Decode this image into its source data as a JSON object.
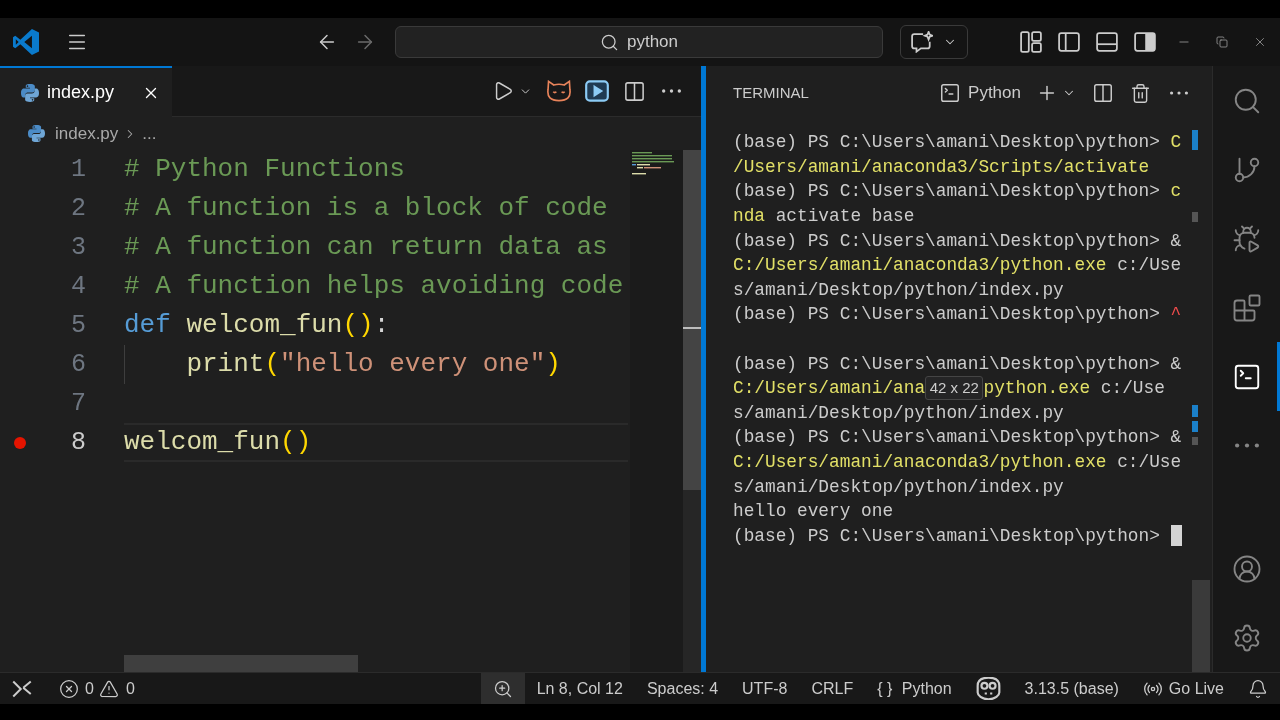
{
  "title_bar": {
    "command_center": "python",
    "layout_toggles": [
      {
        "kind": "primary_sidebar",
        "on": false
      },
      {
        "kind": "panel",
        "on": false
      },
      {
        "kind": "secondary_sidebar",
        "on": true
      }
    ]
  },
  "editor": {
    "tabs": [
      {
        "label": "index.py",
        "selected": true
      }
    ],
    "breadcrumb": [
      "index.py",
      "..."
    ],
    "lines": [
      {
        "number": "1",
        "current": false,
        "breakpoint": false,
        "indented": false,
        "tokens": [
          {
            "text": "# Python Functions",
            "kind": "comment"
          }
        ]
      },
      {
        "number": "2",
        "current": false,
        "breakpoint": false,
        "indented": false,
        "tokens": [
          {
            "text": "# A function is a block of code",
            "kind": "comment"
          }
        ]
      },
      {
        "number": "3",
        "current": false,
        "breakpoint": false,
        "indented": false,
        "tokens": [
          {
            "text": "# A function can return data as",
            "kind": "comment"
          }
        ]
      },
      {
        "number": "4",
        "current": false,
        "breakpoint": false,
        "indented": false,
        "tokens": [
          {
            "text": "# A function helps avoiding code",
            "kind": "comment"
          }
        ]
      },
      {
        "number": "5",
        "current": false,
        "breakpoint": false,
        "indented": false,
        "tokens": [
          {
            "text": "def ",
            "kind": "keyword"
          },
          {
            "text": "welcom_fun",
            "kind": "function"
          },
          {
            "text": "()",
            "kind": "bracket"
          },
          {
            "text": ":",
            "kind": "plain"
          }
        ]
      },
      {
        "number": "6",
        "current": false,
        "breakpoint": false,
        "indented": true,
        "tokens": [
          {
            "text": "print",
            "kind": "function"
          },
          {
            "text": "(",
            "kind": "bracket"
          },
          {
            "text": "\"hello every one\"",
            "kind": "string"
          },
          {
            "text": ")",
            "kind": "bracket"
          }
        ]
      },
      {
        "number": "7",
        "current": false,
        "breakpoint": false,
        "indented": false
      },
      {
        "number": "8",
        "current": true,
        "breakpoint": true,
        "indented": false,
        "tokens": [
          {
            "text": "welcom_fun",
            "kind": "function"
          },
          {
            "text": "()",
            "kind": "bracket"
          }
        ]
      }
    ]
  },
  "terminal": {
    "title": "TERMINAL",
    "shell": "Python",
    "tooltip": "42 x 22",
    "lines": [
      {
        "kind": "text",
        "segments": [
          {
            "text": "(base) PS C:\\Users\\amani\\Desktop\\python> ",
            "kind": "plain"
          },
          {
            "text": "C",
            "kind": "command"
          }
        ]
      },
      {
        "kind": "text",
        "segments": [
          {
            "text": "/Users/amani/anaconda3/Scripts/activate",
            "kind": "command"
          }
        ]
      },
      {
        "kind": "text",
        "segments": [
          {
            "text": "(base) PS C:\\Users\\amani\\Desktop\\python> ",
            "kind": "plain"
          },
          {
            "text": "c",
            "kind": "command"
          }
        ]
      },
      {
        "kind": "text",
        "segments": [
          {
            "text": "nda",
            "kind": "command"
          },
          {
            "text": " activate base",
            "kind": "plain"
          }
        ]
      },
      {
        "kind": "text",
        "segments": [
          {
            "text": "(base) PS C:\\Users\\amani\\Desktop\\python> &",
            "kind": "plain"
          }
        ]
      },
      {
        "kind": "text",
        "segments": [
          {
            "text": "C:/Users/amani/anaconda3/python.exe",
            "kind": "command"
          },
          {
            "text": " c:/Use",
            "kind": "plain"
          }
        ]
      },
      {
        "kind": "text",
        "segments": [
          {
            "text": "s/amani/Desktop/python/index.py",
            "kind": "plain"
          }
        ]
      },
      {
        "kind": "text",
        "segments": [
          {
            "text": "(base) PS C:\\Users\\amani\\Desktop\\python> ",
            "kind": "plain"
          },
          {
            "text": "^",
            "kind": "error"
          }
        ]
      },
      {
        "kind": "blank"
      },
      {
        "kind": "text",
        "segments": [
          {
            "text": "(base) PS C:\\Users\\amani\\Desktop\\python> &",
            "kind": "plain"
          }
        ]
      },
      {
        "kind": "text",
        "segments": [
          {
            "text": "C:/Users/amani/ana",
            "kind": "command"
          },
          {
            "text": "python.exe",
            "kind": "command",
            "tooltip_before": true
          },
          {
            "text": " c:/Use",
            "kind": "plain"
          }
        ]
      },
      {
        "kind": "text",
        "segments": [
          {
            "text": "s/amani/Desktop/python/index.py",
            "kind": "plain"
          }
        ]
      },
      {
        "kind": "text",
        "segments": [
          {
            "text": "(base) PS C:\\Users\\amani\\Desktop\\python> &",
            "kind": "plain"
          }
        ]
      },
      {
        "kind": "text",
        "segments": [
          {
            "text": "C:/Users/amani/anaconda3/python.exe",
            "kind": "command"
          },
          {
            "text": " c:/Use",
            "kind": "plain"
          }
        ]
      },
      {
        "kind": "text",
        "segments": [
          {
            "text": "s/amani/Desktop/python/index.py",
            "kind": "plain"
          }
        ]
      },
      {
        "kind": "text",
        "segments": [
          {
            "text": "hello every one",
            "kind": "plain"
          }
        ]
      },
      {
        "kind": "text",
        "cursor": true,
        "segments": [
          {
            "text": "(base) PS C:\\Users\\amani\\Desktop\\python> ",
            "kind": "plain"
          }
        ]
      }
    ]
  },
  "activity_bar": {
    "items": [
      {
        "kind": "search",
        "selected": false
      },
      {
        "kind": "source_control",
        "selected": false
      },
      {
        "kind": "run_debug",
        "selected": false
      },
      {
        "kind": "extensions",
        "selected": false
      },
      {
        "kind": "terminal",
        "selected": true
      },
      {
        "kind": "more",
        "selected": false
      }
    ],
    "bottom_items": [
      {
        "kind": "account",
        "selected": false
      },
      {
        "kind": "settings",
        "selected": false
      }
    ]
  },
  "status_bar": {
    "left": [
      {
        "kind": "remote"
      },
      {
        "kind": "problems",
        "errors": "0",
        "warnings": "0"
      }
    ],
    "right": [
      {
        "kind": "zoom",
        "highlighted": true
      },
      {
        "kind": "position",
        "label": "Ln 8, Col 12"
      },
      {
        "kind": "indentation",
        "label": "Spaces: 4"
      },
      {
        "kind": "encoding",
        "label": "UTF-8"
      },
      {
        "kind": "line_ending",
        "label": "CRLF"
      },
      {
        "kind": "language",
        "icon": "{ }",
        "label": "Python"
      },
      {
        "kind": "copilot"
      },
      {
        "kind": "interpreter",
        "label": "3.13.5 (base)"
      },
      {
        "kind": "live",
        "label": "Go Live"
      },
      {
        "kind": "notifications"
      }
    ]
  }
}
